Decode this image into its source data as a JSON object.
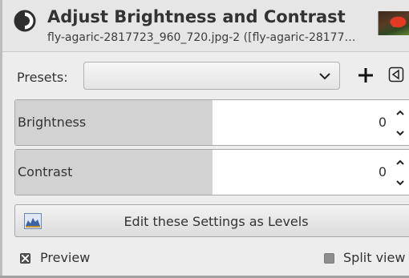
{
  "header": {
    "title": "Adjust Brightness and Contrast",
    "subtitle": "fly-agaric-2817723_960_720.jpg-2 ([fly-agaric-28177…"
  },
  "presets": {
    "label": "Presets:",
    "selected": ""
  },
  "brightness": {
    "label": "Brightness",
    "value": "0",
    "level": 0.5
  },
  "contrast": {
    "label": "Contrast",
    "value": "0",
    "level": 0.5
  },
  "levels_button": {
    "label": "Edit these Settings as Levels"
  },
  "options": {
    "preview_label": "Preview",
    "preview_checked": true,
    "split_view_label": "Split view",
    "split_view_checked": false
  },
  "icons": {
    "tool": "brightness-contrast-icon",
    "add": "plus-icon",
    "menu": "triangle-menu-icon",
    "levels": "levels-histogram-icon",
    "spin_up": "chevron-up-icon",
    "spin_down": "chevron-down-icon"
  }
}
